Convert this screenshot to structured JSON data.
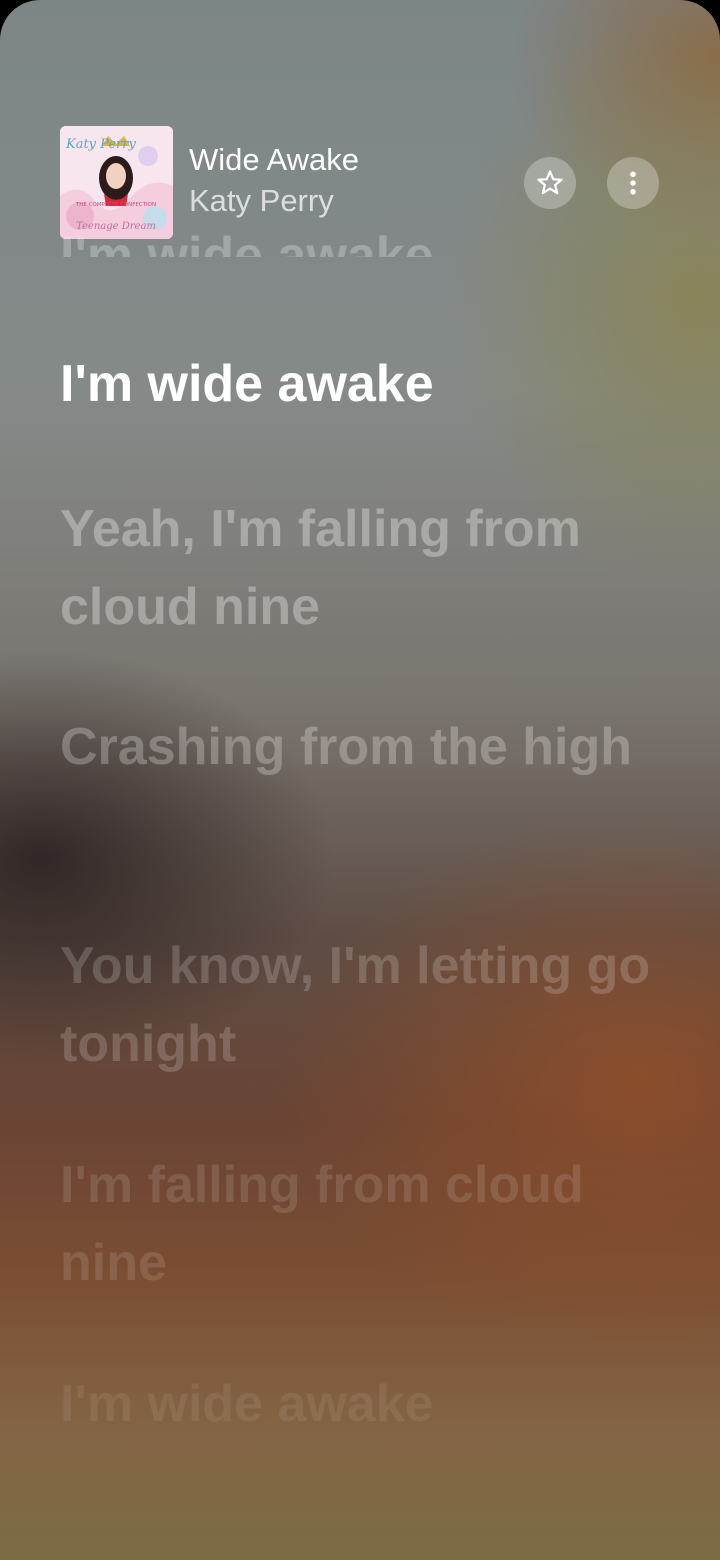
{
  "now_playing": {
    "title": "Wide Awake",
    "artist": "Katy Perry",
    "album_art": {
      "artist_text": "Katy Perry",
      "edition_text": "THE COMPLETE CONFECTION",
      "album_text": "Teenage Dream"
    }
  },
  "controls": {
    "favorite_icon": "star-icon",
    "more_icon": "more-vertical-icon"
  },
  "lyrics": {
    "previous_partial": "I'm wide awake",
    "current": "I'm wide awake",
    "upcoming": [
      "Yeah, I'm falling from cloud nine",
      "Crashing from the high",
      "You know, I'm letting go tonight",
      "I'm falling from cloud nine",
      "I'm wide awake"
    ]
  },
  "colors": {
    "background_top": "#7d8687",
    "background_bottom": "#7b6c43",
    "text_active": "#ffffff"
  }
}
